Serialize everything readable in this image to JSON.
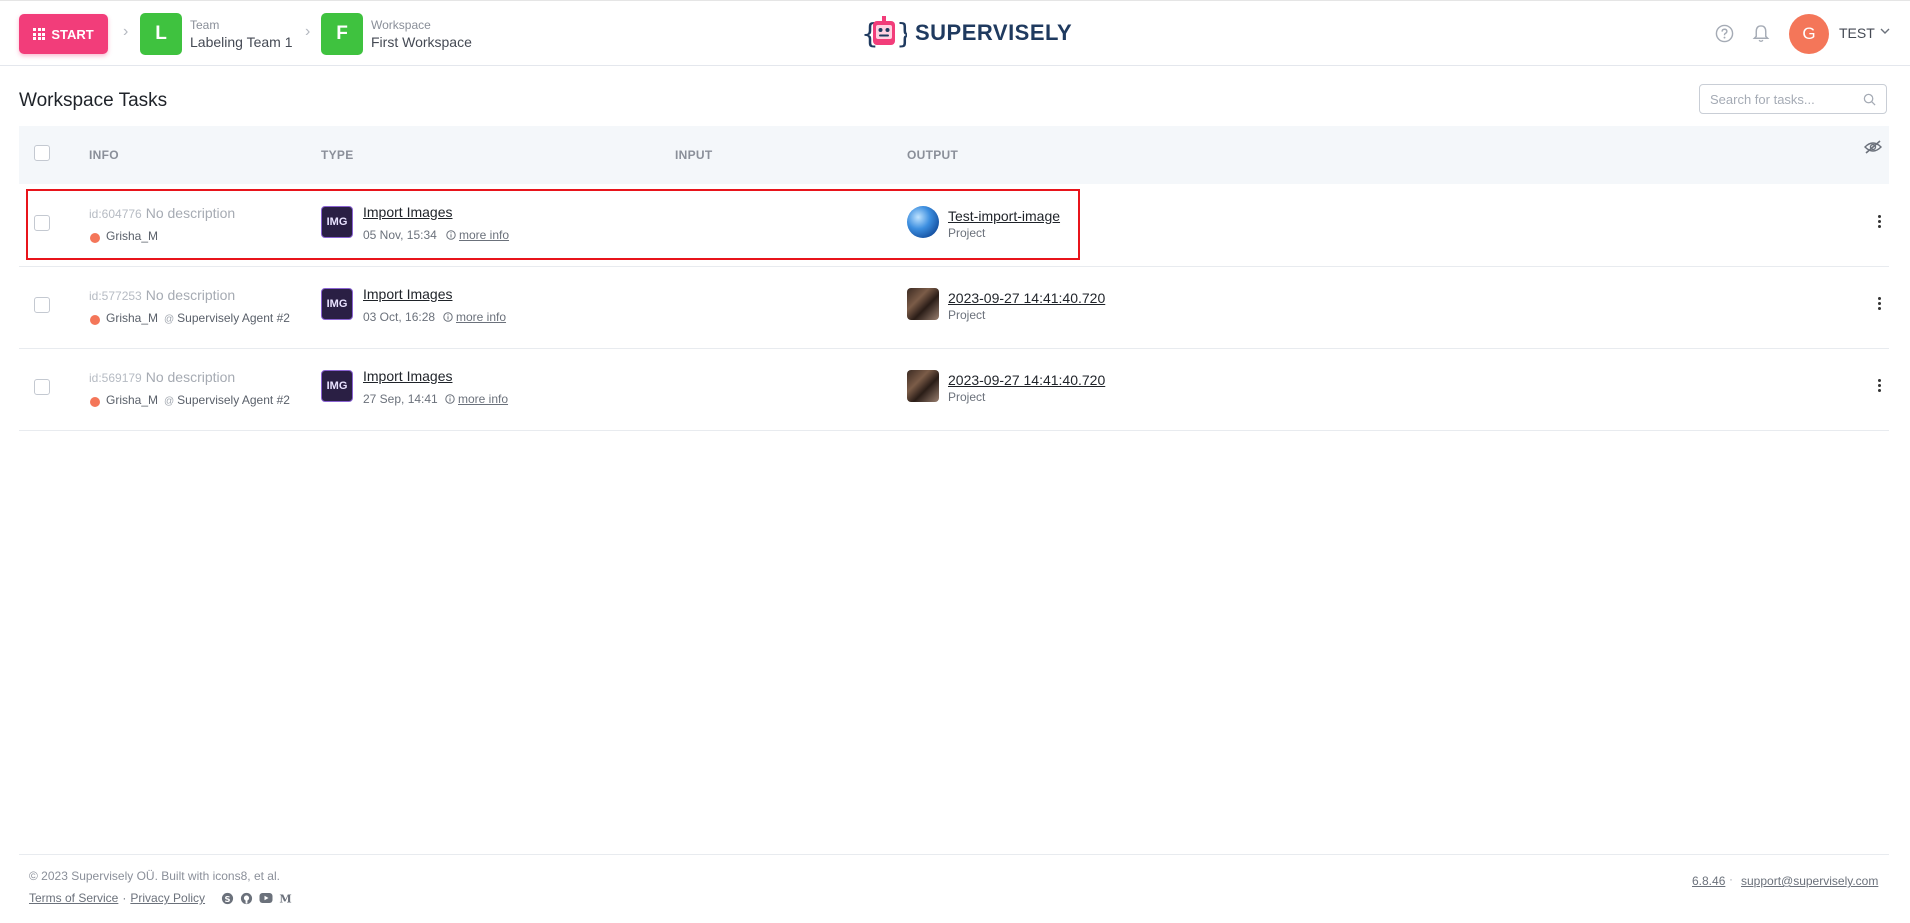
{
  "header": {
    "start_label": "START",
    "team": {
      "kind": "Team",
      "name": "Labeling Team 1",
      "initial": "L"
    },
    "workspace": {
      "kind": "Workspace",
      "name": "First Workspace",
      "initial": "F"
    },
    "logo_text": "SUPERVISELY",
    "user": {
      "initial": "G",
      "name": "TEST"
    }
  },
  "page": {
    "title": "Workspace Tasks",
    "search_placeholder": "Search for tasks..."
  },
  "table": {
    "columns": [
      "INFO",
      "TYPE",
      "INPUT",
      "OUTPUT"
    ],
    "rows": [
      {
        "id": "id:604776",
        "description": "No description",
        "user": "Grisha_M",
        "agent": "",
        "type_icon": "IMG",
        "type_name": "Import Images",
        "date": "05 Nov, 15:34",
        "more_info": "more info",
        "input": "",
        "output_name": "Test-import-image",
        "output_kind": "Project",
        "highlighted": true
      },
      {
        "id": "id:577253",
        "description": "No description",
        "user": "Grisha_M",
        "agent": "Supervisely Agent #2",
        "type_icon": "IMG",
        "type_name": "Import Images",
        "date": "03 Oct, 16:28",
        "more_info": "more info",
        "input": "",
        "output_name": "2023-09-27 14:41:40.720",
        "output_kind": "Project",
        "highlighted": false
      },
      {
        "id": "id:569179",
        "description": "No description",
        "user": "Grisha_M",
        "agent": "Supervisely Agent #2",
        "type_icon": "IMG",
        "type_name": "Import Images",
        "date": "27 Sep, 14:41",
        "more_info": "more info",
        "input": "",
        "output_name": "2023-09-27 14:41:40.720",
        "output_kind": "Project",
        "highlighted": false
      }
    ]
  },
  "footer": {
    "copyright": "© 2023 Supervisely OÜ. Built with icons8, et al.",
    "terms": "Terms of Service",
    "separator": "·",
    "privacy": "Privacy Policy",
    "version": "6.8.46",
    "support": "support@supervisely.com"
  },
  "colors": {
    "start": "#f23d7a",
    "crumb_avatar": "#3fc23f",
    "user_avatar": "#f47659",
    "highlight": "#e8141b"
  }
}
